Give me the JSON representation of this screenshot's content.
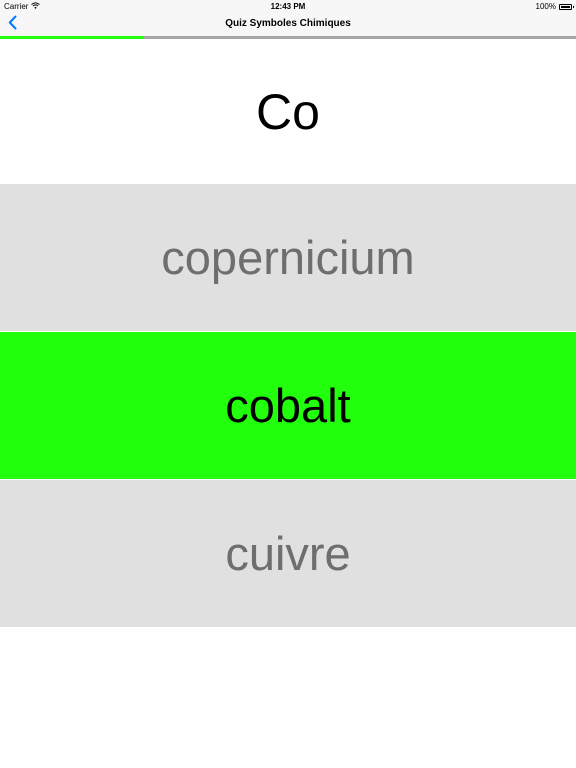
{
  "status_bar": {
    "carrier": "Carrier",
    "time": "12:43 PM",
    "battery": "100%"
  },
  "nav": {
    "title": "Quiz Symboles Chimiques"
  },
  "progress": {
    "fraction": 0.25,
    "fill_color": "#24ff0f",
    "track_color": "#a6a6a6"
  },
  "question": {
    "symbol": "Co"
  },
  "answers": [
    {
      "label": "copernicium",
      "state": "unselected"
    },
    {
      "label": "cobalt",
      "state": "correct"
    },
    {
      "label": "cuivre",
      "state": "unselected"
    }
  ],
  "colors": {
    "accent": "#007aff",
    "correct": "#22ff0d",
    "answer_bg": "#e0e0e0",
    "answer_text": "#6e6e6e"
  },
  "icons": {
    "back": "chevron-left-icon",
    "wifi": "wifi-icon",
    "battery": "battery-icon"
  }
}
